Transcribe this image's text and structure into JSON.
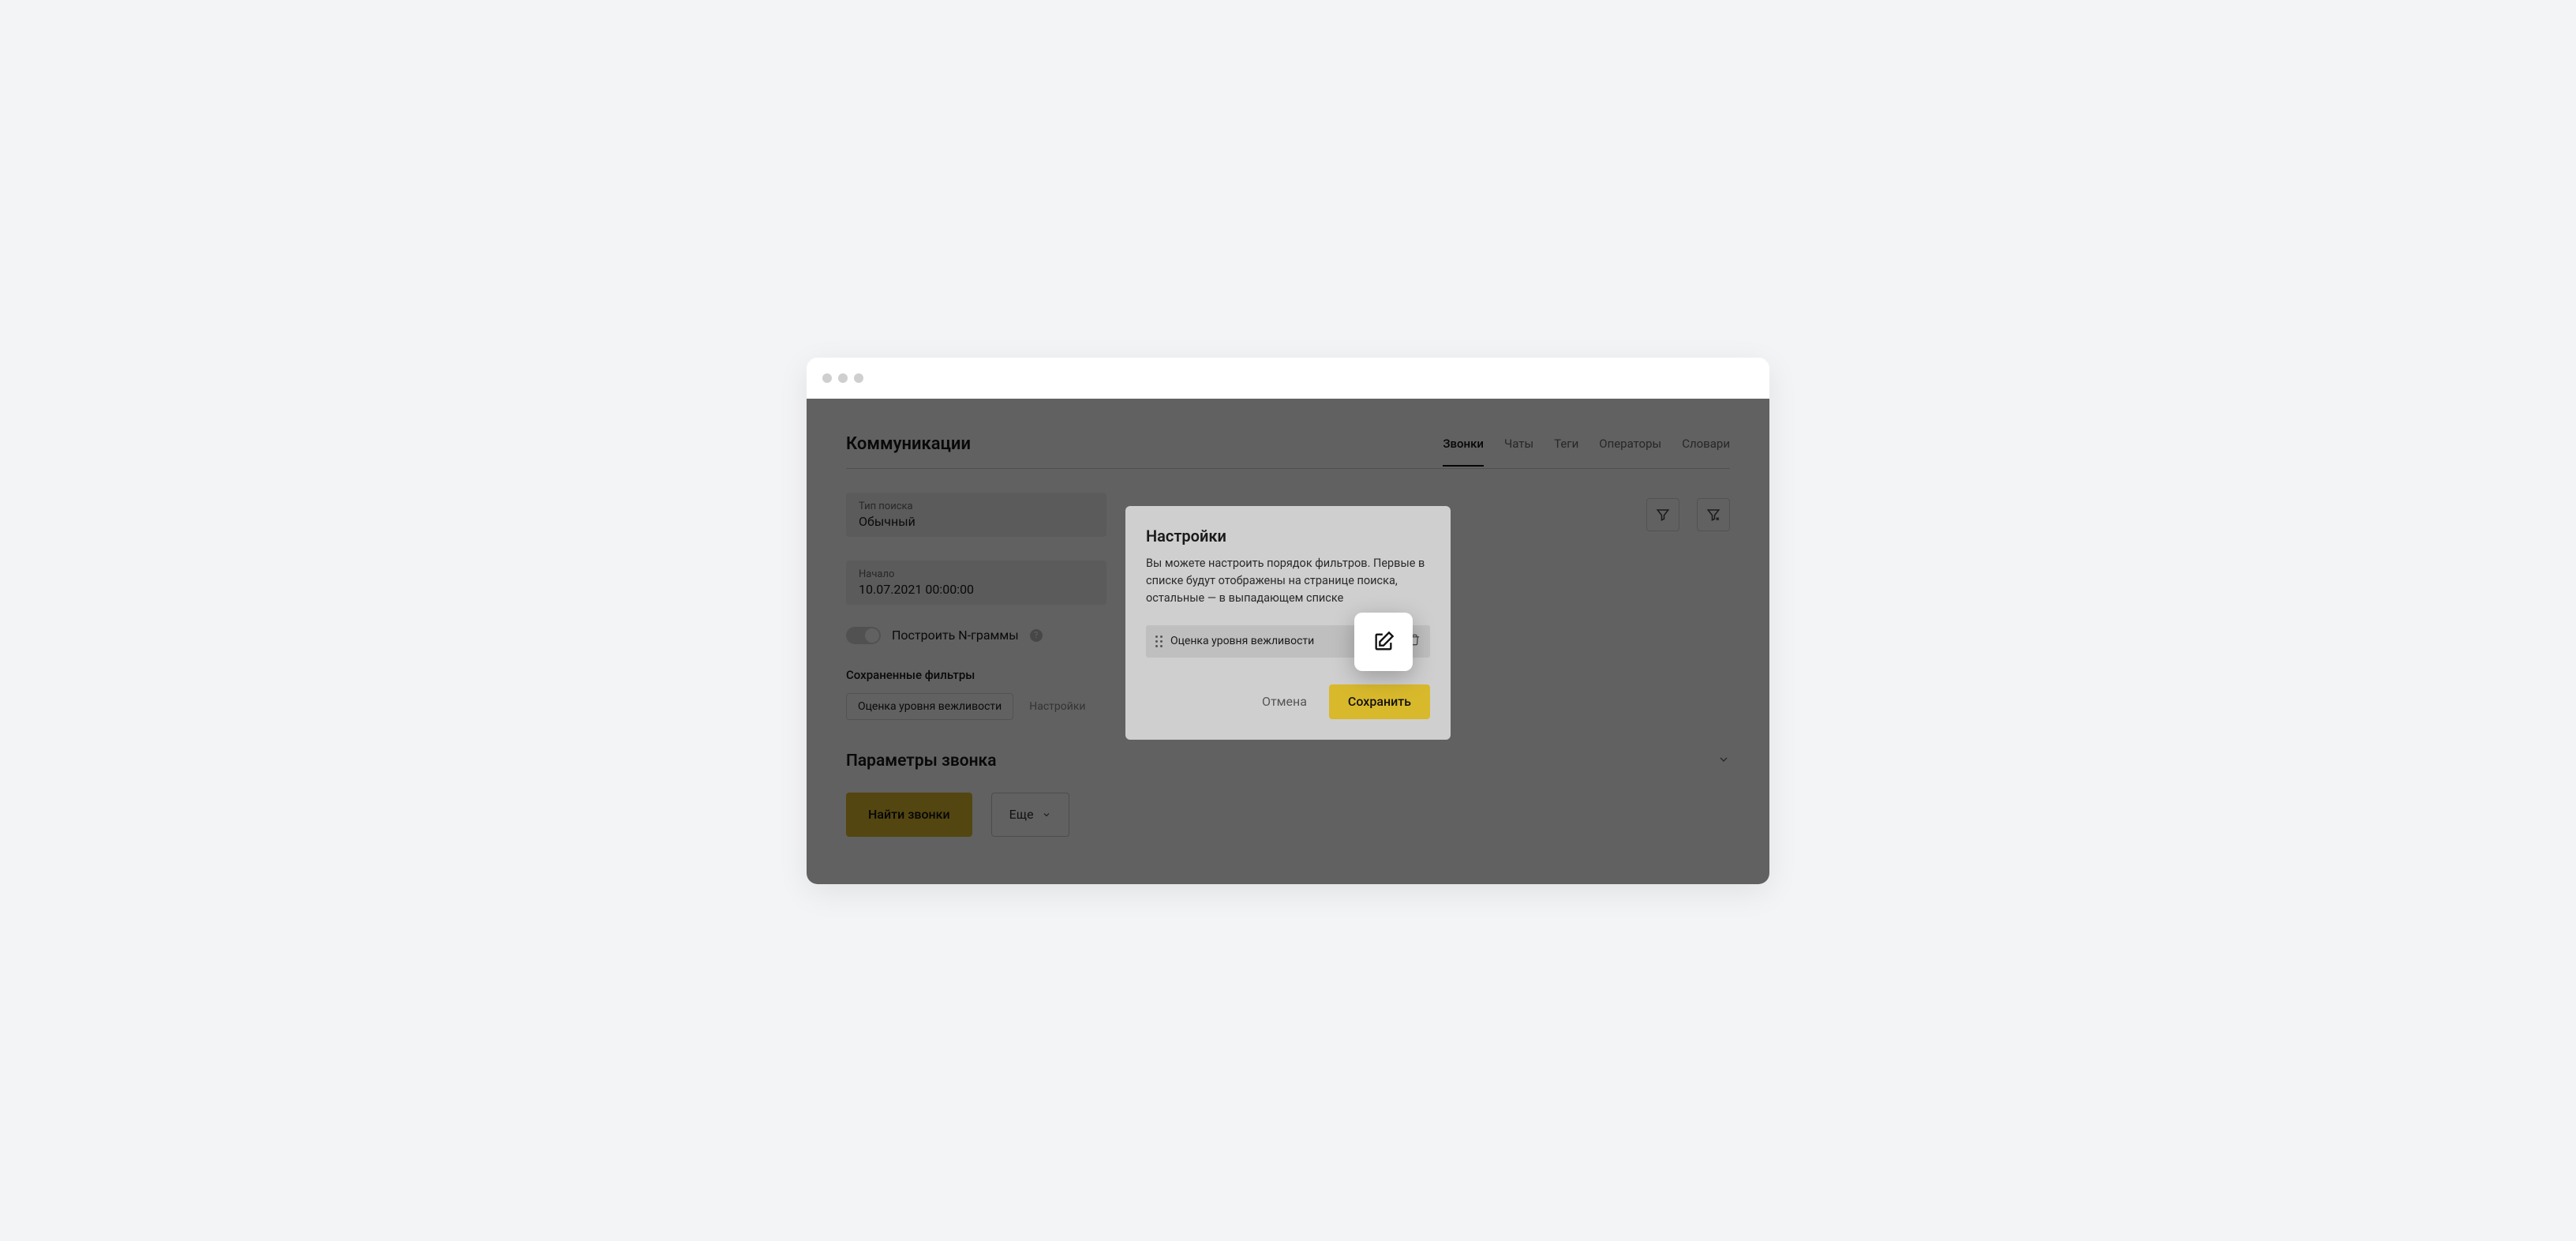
{
  "page_title": "Коммуникации",
  "tabs": [
    "Звонки",
    "Чаты",
    "Теги",
    "Операторы",
    "Словари"
  ],
  "active_tab": 0,
  "search_type": {
    "label": "Тип поиска",
    "value": "Обычный"
  },
  "start": {
    "label": "Начало",
    "value": "10.07.2021 00:00:00"
  },
  "ngram": {
    "label": "Построить N-граммы"
  },
  "saved_filters": {
    "title": "Сохраненные фильтры",
    "items": [
      "Оценка уровня вежливости"
    ],
    "settings": "Настройки"
  },
  "accordion": "Параметры звонка",
  "find_btn": "Найти звонки",
  "more_btn": "Еще",
  "dialog": {
    "title": "Настройки",
    "desc": "Вы можете настроить порядок фильтров. Первые в списке будут отображены на странице поиска, остальные — в выпадающем списке",
    "item": "Оценка уровня вежливости",
    "cancel": "Отмена",
    "save": "Сохранить"
  }
}
